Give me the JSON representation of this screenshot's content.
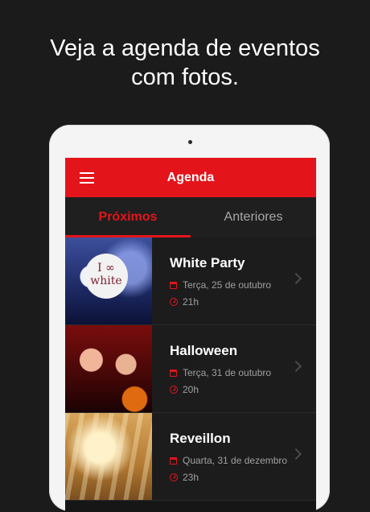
{
  "headline": {
    "line1": "Veja a agenda de eventos",
    "line2": "com fotos."
  },
  "app": {
    "title": "Agenda",
    "menu_icon": "hamburger-menu-icon",
    "accent_color": "#e3151b"
  },
  "tabs": [
    {
      "label": "Próximos",
      "active": true
    },
    {
      "label": "Anteriores",
      "active": false
    }
  ],
  "events": [
    {
      "title": "White Party",
      "date": "Terça, 25 de outubro",
      "time": "21h",
      "photo_text": "I ∞ white"
    },
    {
      "title": "Halloween",
      "date": "Terça, 31 de outubro",
      "time": "20h"
    },
    {
      "title": "Reveillon",
      "date": "Quarta, 31 de dezembro",
      "time": "23h"
    }
  ]
}
